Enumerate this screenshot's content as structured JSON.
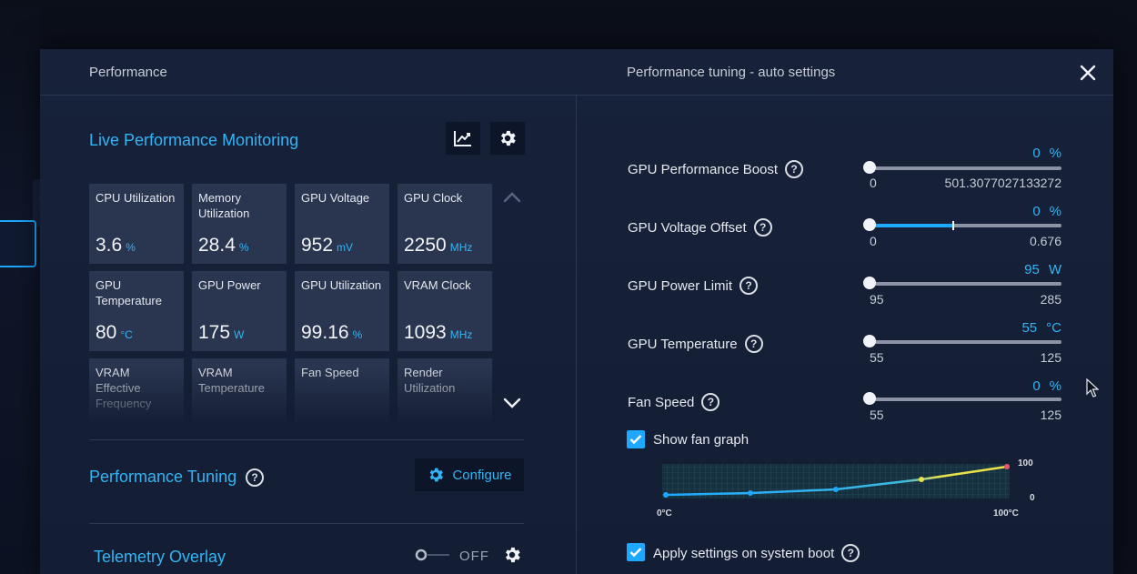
{
  "header": {
    "left_title": "Performance",
    "right_title": "Performance tuning - auto settings"
  },
  "monitoring": {
    "title": "Live Performance Monitoring",
    "chart_icon": "line-chart-icon",
    "settings_icon": "gear-icon",
    "tiles": [
      {
        "label": "CPU Utilization",
        "value": "3.6",
        "unit": "%"
      },
      {
        "label": "Memory Utilization",
        "value": "28.4",
        "unit": "%"
      },
      {
        "label": "GPU Voltage",
        "value": "952",
        "unit": "mV"
      },
      {
        "label": "GPU Clock",
        "value": "2250",
        "unit": "MHz"
      },
      {
        "label": "GPU Temperature",
        "value": "80",
        "unit": "°C"
      },
      {
        "label": "GPU Power",
        "value": "175",
        "unit": "W"
      },
      {
        "label": "GPU Utilization",
        "value": "99.16",
        "unit": "%"
      },
      {
        "label": "VRAM Clock",
        "value": "1093",
        "unit": "MHz"
      },
      {
        "label": "VRAM Effective Frequency",
        "value": "",
        "unit": ""
      },
      {
        "label": "VRAM Temperature",
        "value": "",
        "unit": ""
      },
      {
        "label": "Fan Speed",
        "value": "",
        "unit": ""
      },
      {
        "label": "Render Utilization",
        "value": "",
        "unit": ""
      }
    ]
  },
  "tuning": {
    "title": "Performance Tuning",
    "configure_label": "Configure"
  },
  "overlay": {
    "title": "Telemetry Overlay",
    "toggle_label": "OFF"
  },
  "settings": [
    {
      "label": "GPU Performance Boost",
      "current": "0",
      "unit": "%",
      "min": "0",
      "max": "501.3077027133272",
      "fill_fraction": 0
    },
    {
      "label": "GPU Voltage Offset",
      "current": "0",
      "unit": "%",
      "min": "0",
      "max": "0.676",
      "fill_fraction": 0.43
    },
    {
      "label": "GPU Power Limit",
      "current": "95",
      "unit": "W",
      "min": "95",
      "max": "285",
      "fill_fraction": 0
    },
    {
      "label": "GPU Temperature",
      "current": "55",
      "unit": "°C",
      "min": "55",
      "max": "125",
      "fill_fraction": 0
    },
    {
      "label": "Fan Speed",
      "current": "0",
      "unit": "%",
      "min": "55",
      "max": "125",
      "fill_fraction": 0
    }
  ],
  "fan_graph": {
    "checkbox_label": "Show fan graph",
    "checked": true,
    "y_max_label": "100",
    "y_min_label": "0",
    "x_min_label": "0°C",
    "x_max_label": "100°C"
  },
  "apply_boot": {
    "checkbox_label": "Apply settings on system boot",
    "checked": true
  },
  "colors": {
    "accent": "#33b5f5",
    "slider_fill": "#1fa8ff",
    "curve_low": "#1fa8ff",
    "curve_high": "#e7e14a",
    "curve_max": "#e8556b"
  }
}
